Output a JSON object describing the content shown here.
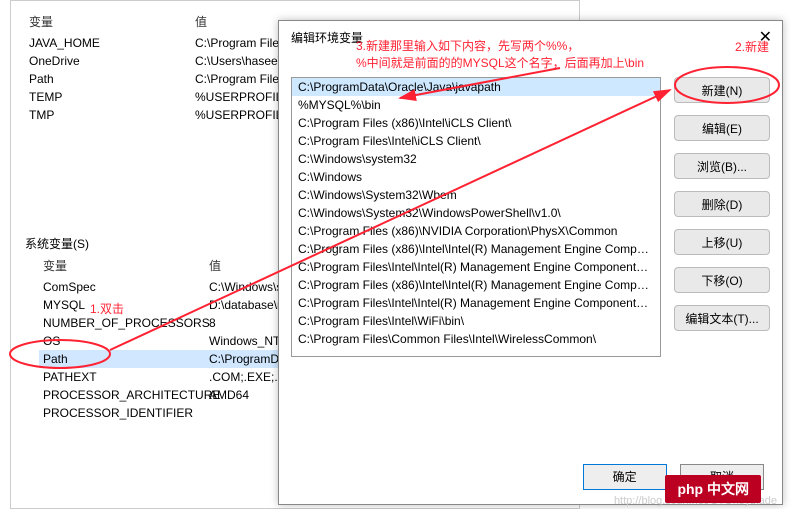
{
  "bg": {
    "head_var": "变量",
    "head_val": "值",
    "user_vars": [
      {
        "name": "JAVA_HOME",
        "value": "C:\\Program Files\\"
      },
      {
        "name": "OneDrive",
        "value": "C:\\Users\\hasee\\"
      },
      {
        "name": "Path",
        "value": "C:\\Program Files\\"
      },
      {
        "name": "TEMP",
        "value": "%USERPROFILE%"
      },
      {
        "name": "TMP",
        "value": "%USERPROFILE%"
      }
    ],
    "section": "系统变量(S)",
    "sys_vars": [
      {
        "name": "ComSpec",
        "value": "C:\\Windows\\sys"
      },
      {
        "name": "MYSQL",
        "value": "D:\\database\\my"
      },
      {
        "name": "NUMBER_OF_PROCESSORS",
        "value": "8"
      },
      {
        "name": "OS",
        "value": "Windows_NT"
      },
      {
        "name": "Path",
        "value": "C:\\ProgramData"
      },
      {
        "name": "PATHEXT",
        "value": ".COM;.EXE;.BAT;"
      },
      {
        "name": "PROCESSOR_ARCHITECTURE",
        "value": "AMD64"
      },
      {
        "name": "PROCESSOR_IDENTIFIER",
        "value": ""
      }
    ]
  },
  "dialog": {
    "title": "编辑环境变量",
    "close": "✕",
    "ann3": "3.新建那里输入如下内容，先写两个%%，\n%中间就是前面的的MYSQL这个名字，后面再加上\\bin",
    "ann2": "2.新建",
    "ann1": "1.双击",
    "items": [
      "C:\\ProgramData\\Oracle\\Java\\javapath",
      "%MYSQL%\\bin",
      "C:\\Program Files (x86)\\Intel\\iCLS Client\\",
      "C:\\Program Files\\Intel\\iCLS Client\\",
      "C:\\Windows\\system32",
      "C:\\Windows",
      "C:\\Windows\\System32\\Wbem",
      "C:\\Windows\\System32\\WindowsPowerShell\\v1.0\\",
      "C:\\Program Files (x86)\\NVIDIA Corporation\\PhysX\\Common",
      "C:\\Program Files (x86)\\Intel\\Intel(R) Management Engine Compon...",
      "C:\\Program Files\\Intel\\Intel(R) Management Engine Components\\...",
      "C:\\Program Files (x86)\\Intel\\Intel(R) Management Engine Compon...",
      "C:\\Program Files\\Intel\\Intel(R) Management Engine Components\\I...",
      "C:\\Program Files\\Intel\\WiFi\\bin\\",
      "C:\\Program Files\\Common Files\\Intel\\WirelessCommon\\"
    ],
    "buttons": {
      "new": "新建(N)",
      "edit": "编辑(E)",
      "browse": "浏览(B)...",
      "delete": "删除(D)",
      "up": "上移(U)",
      "down": "下移(O)",
      "edit_text": "编辑文本(T)...",
      "ok": "确定",
      "cancel": "取消"
    }
  },
  "watermark": "http://blog.csdn.net/CTOkeyblade",
  "logo": "php 中文网"
}
